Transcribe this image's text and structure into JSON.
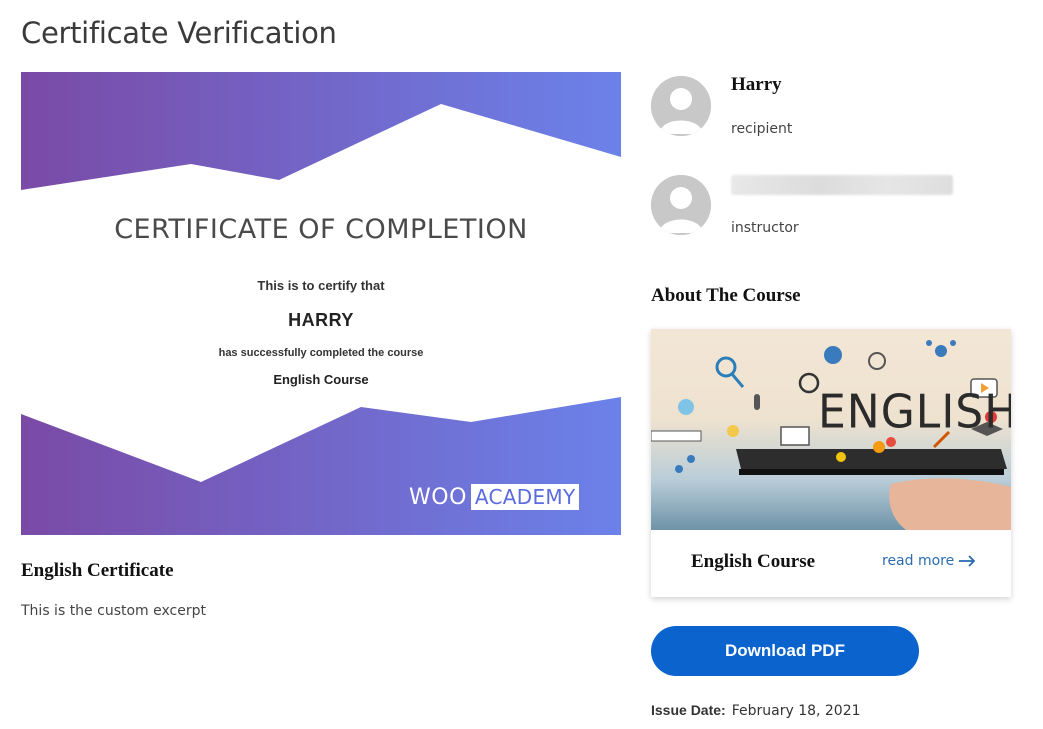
{
  "page": {
    "title": "Certificate Verification"
  },
  "certificate": {
    "heading": "CERTIFICATE OF COMPLETION",
    "line1": "This is to certify that",
    "recipient_name": "HARRY",
    "line2": "has successfully completed the course",
    "course_name": "English Course",
    "logo_left": "WOO",
    "logo_right": "ACADEMY",
    "colors": {
      "gradient_start": "#7a4aa6",
      "gradient_end": "#6b82ea"
    }
  },
  "cert_info": {
    "title": "English Certificate",
    "excerpt": "This is the custom excerpt"
  },
  "people": [
    {
      "name": "Harry",
      "role": "recipient",
      "icon": "user-avatar-icon"
    },
    {
      "name": "",
      "role": "instructor",
      "icon": "user-avatar-icon",
      "name_redacted": true
    }
  ],
  "about": {
    "heading": "About The Course"
  },
  "course_card": {
    "image_text": "ENGLISH",
    "title": "English Course",
    "read_more": "read more",
    "read_more_icon": "arrow-right-icon"
  },
  "actions": {
    "download_label": "Download PDF",
    "accent": "#0b63ce"
  },
  "issue": {
    "label": "Issue Date:",
    "date": "February 18, 2021"
  }
}
